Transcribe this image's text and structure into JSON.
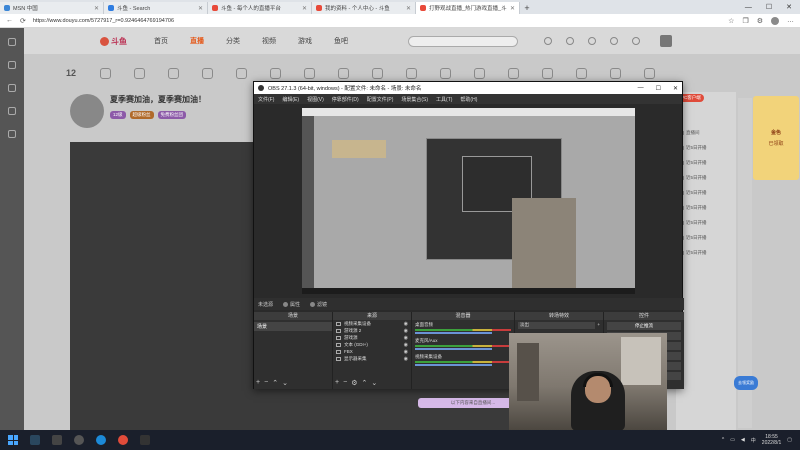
{
  "browser": {
    "tabs": [
      {
        "label": "MSN 中国"
      },
      {
        "label": "斗鱼 - Search"
      },
      {
        "label": "斗鱼 - 每个人的直播平台"
      },
      {
        "label": "我的资料 - 个人中心 - 斗鱼"
      },
      {
        "label": "打野观战直播_热门游戏直播_斗鱼..."
      }
    ],
    "new_tab": "+",
    "url": "https://www.douyu.com/5727917_r=0.9246464769194706"
  },
  "site": {
    "logo": "斗鱼",
    "nav": [
      "首页",
      "直播",
      "分类",
      "视频",
      "游戏",
      "鱼吧"
    ],
    "active_nav": "直播",
    "level": "12",
    "room_title": "夏季赛加油，夏季赛加油！",
    "tags": [
      "12级",
      "超级粉丝",
      "免费粉丝团"
    ],
    "right_pill": "PC客户端",
    "rank_items": [
      "直播间",
      "近5日开播",
      "近5日开播",
      "近5日开播",
      "近5日开播",
      "近5日开播",
      "近5日开播",
      "近5日开播",
      "近5日开播"
    ],
    "promo_title": "金色",
    "promo_sub": "已领取",
    "float_badge": "去领奖励",
    "bottom_note": "以下内容来自直播间..."
  },
  "obs": {
    "title": "OBS 27.1.3 (64-bit, windows) - 配置文件: 未命名 - 场景: 未命名",
    "menu": [
      "文件(F)",
      "编辑(E)",
      "视图(V)",
      "停靠部件(D)",
      "配置文件(P)",
      "场景集合(S)",
      "工具(T)",
      "帮助(H)"
    ],
    "sub_left": "未选源",
    "sub_btn1": "属性",
    "sub_btn2": "滤镜",
    "docks": {
      "scenes": "场景",
      "sources": "来源",
      "mixer": "混音器",
      "transitions": "转场特效",
      "controls": "控件"
    },
    "scene_item": "场景",
    "sources": [
      "视频采集设备",
      "游戏源 2",
      "游戏源",
      "文本 (GDI+)",
      "FBX",
      "显示器采集"
    ],
    "mixer": [
      {
        "label": "桌面音频"
      },
      {
        "label": "麦克风/Aux"
      },
      {
        "label": "视频采集设备"
      }
    ],
    "transition": "淡出",
    "transition_duration": "300 ms",
    "controls": [
      "停止推流",
      "开始录制",
      "启动虚拟摄像机",
      "工作室模式",
      "设置",
      "退出"
    ]
  },
  "taskbar": {
    "time": "18:55",
    "date": "2022/8/1",
    "lang": "中"
  }
}
